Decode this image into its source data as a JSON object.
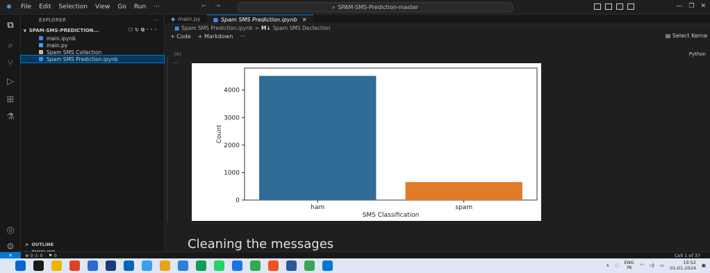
{
  "titlebar": {
    "menu": [
      "File",
      "Edit",
      "Selection",
      "View",
      "Go",
      "Run",
      "···"
    ],
    "search": "SPAM-SMS-Prediction-master"
  },
  "sidebar": {
    "title": "EXPLORER",
    "title_more": "···",
    "folder": "SPAM-SMS-PREDICTION...",
    "files": [
      {
        "name": "main.ipynb",
        "color": "#3b8eea"
      },
      {
        "name": "main.py",
        "color": "#4b9fe0"
      },
      {
        "name": "Spam SMS Collection",
        "color": "#d7ba7d"
      },
      {
        "name": "Spam SMS Prediction.ipynb",
        "color": "#3b8eea"
      }
    ],
    "outline": "OUTLINE",
    "timeline": "TIMELINE"
  },
  "editor": {
    "tabs": [
      {
        "label": "main.py",
        "active": false
      },
      {
        "label": "Spam SMS Prediction.ipynb",
        "active": true
      }
    ],
    "tab_close": "✕",
    "breadcrumb": {
      "file": "Spam SMS Prediction.ipynb",
      "sep": ">",
      "md_badge": "M↓",
      "section": "Spam SMS Dectection"
    },
    "toolbar": {
      "code": "+ Code",
      "markdown": "+ Markdown",
      "more": "···",
      "select_kernel": "Select Kerne"
    },
    "kernel_language": "Python",
    "execution_count": "[9]",
    "cell_more": "···",
    "markdown_heading": "Cleaning the messages"
  },
  "chart_data": {
    "type": "bar",
    "categories": [
      "ham",
      "spam"
    ],
    "values": [
      4516,
      653
    ],
    "colors": [
      "#2f6c96",
      "#e07b2a"
    ],
    "xlabel": "SMS Classification",
    "ylabel": "Count",
    "ylim": [
      0,
      4800
    ],
    "yticks": [
      0,
      1000,
      2000,
      3000,
      4000
    ],
    "grid": false
  },
  "statusbar": {
    "remote": "✕",
    "problems": "⊗ 0 ⚠ 0",
    "ports": "⚑ 0",
    "cell_info": "Cell 1 of 37"
  },
  "taskbar": {
    "lang_top": "ENG",
    "lang_bottom": "IN",
    "time": "19:52",
    "date": "01-01-2024",
    "apps": [
      "#0a64d8",
      "#1b1b1b",
      "#f0b400",
      "#e0402a",
      "#2a6bd6",
      "#1d3a78",
      "#0067b8",
      "#3aa0ee",
      "#e8a317",
      "#2e7fd8",
      "#0f9d58",
      "#25d366",
      "#1a73e8",
      "#34a853",
      "#f4511e",
      "#2b579a",
      "#3aa757",
      "#0078d4"
    ]
  }
}
